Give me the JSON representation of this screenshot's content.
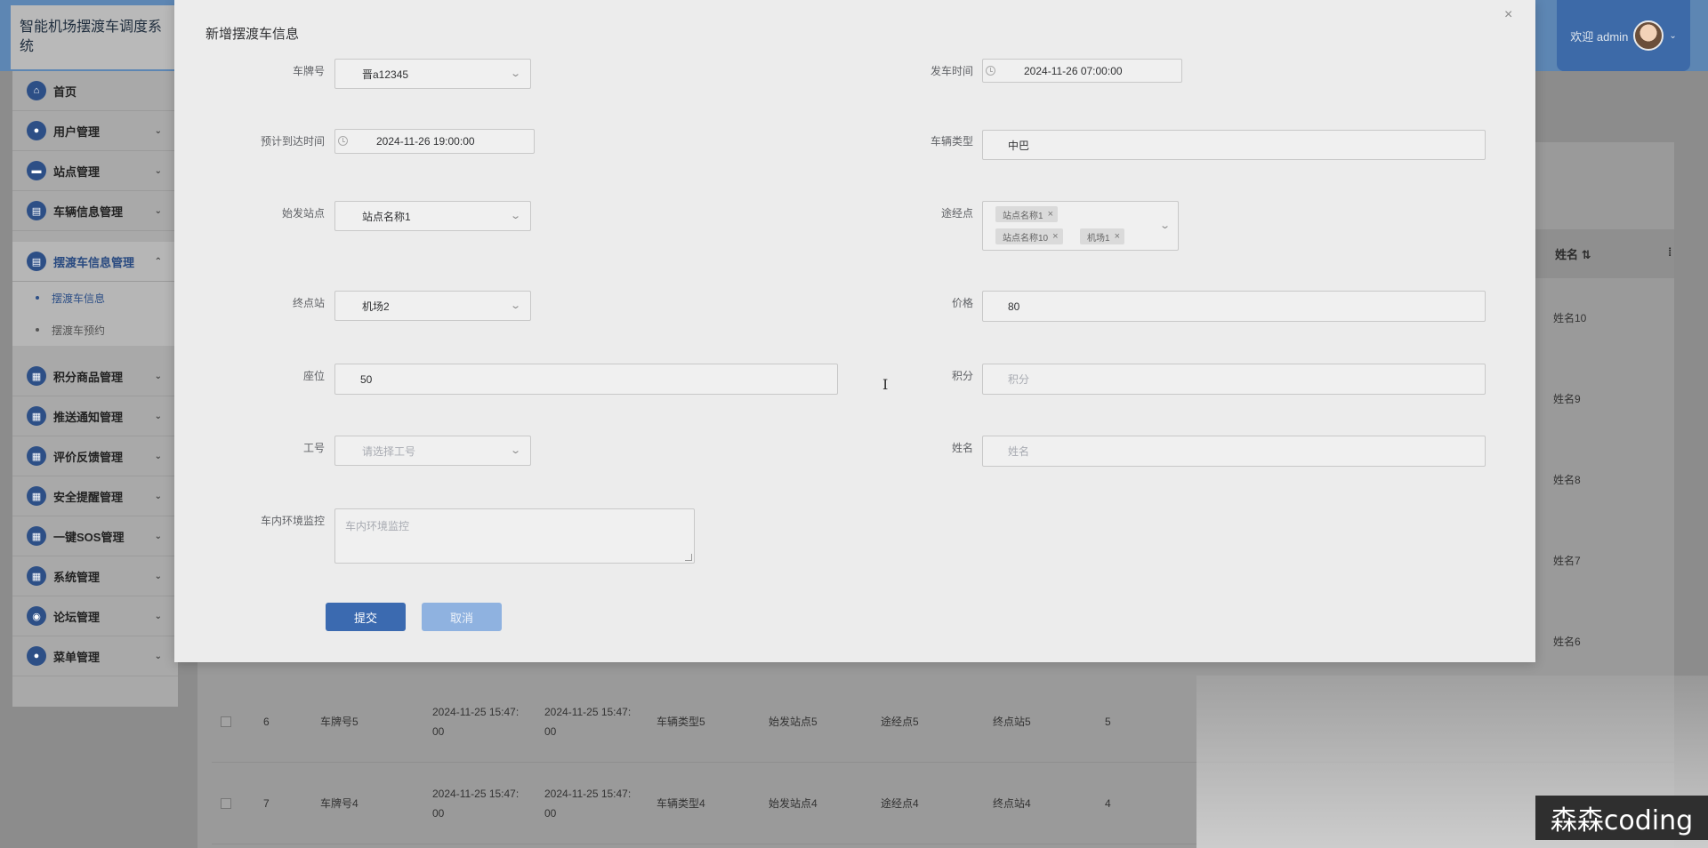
{
  "app": {
    "title": "智能机场摆渡车调度系统",
    "welcome": "欢迎 admin"
  },
  "sidebar": {
    "items": [
      {
        "label": "首页",
        "icon": "home-icon"
      },
      {
        "label": "用户管理",
        "icon": "user-icon"
      },
      {
        "label": "站点管理",
        "icon": "station-icon"
      },
      {
        "label": "车辆信息管理",
        "icon": "vehicle-icon"
      }
    ],
    "group": {
      "label": "摆渡车信息管理",
      "icon": "shuttle-icon",
      "children": [
        {
          "label": "摆渡车信息"
        },
        {
          "label": "摆渡车预约"
        }
      ]
    },
    "items_after": [
      {
        "label": "积分商品管理",
        "icon": "points-goods-icon"
      },
      {
        "label": "推送通知管理",
        "icon": "notification-icon"
      },
      {
        "label": "评价反馈管理",
        "icon": "feedback-icon"
      },
      {
        "label": "安全提醒管理",
        "icon": "safety-icon"
      },
      {
        "label": "一键SOS管理",
        "icon": "sos-icon"
      },
      {
        "label": "系统管理",
        "icon": "system-icon"
      },
      {
        "label": "论坛管理",
        "icon": "forum-icon"
      },
      {
        "label": "菜单管理",
        "icon": "menu-icon"
      }
    ]
  },
  "table": {
    "header_name": "姓名",
    "header_sort": "⇅",
    "visible_names": [
      "姓名10",
      "姓名9",
      "姓名8",
      "姓名7",
      "姓名6"
    ],
    "rows": [
      {
        "index": "6",
        "plate": "车牌号5",
        "depart": "2024-11-25 15:47:",
        "depart2": "00",
        "arrive": "2024-11-25 15:47:",
        "arrive2": "00",
        "type": "车辆类型5",
        "start": "始发站点5",
        "via": "途经点5",
        "end": "终点站5",
        "price": "5"
      },
      {
        "index": "7",
        "plate": "车牌号4",
        "depart": "2024-11-25 15:47:",
        "depart2": "00",
        "arrive": "2024-11-25 15:47:",
        "arrive2": "00",
        "type": "车辆类型4",
        "start": "始发站点4",
        "via": "途经点4",
        "end": "终点站4",
        "price": "4"
      }
    ]
  },
  "modal": {
    "title": "新增摆渡车信息",
    "close": "×",
    "fields": {
      "plate": {
        "label": "车牌号",
        "value": "晋a12345"
      },
      "depart_time": {
        "label": "发车时间",
        "value": "2024-11-26 07:00:00"
      },
      "arrive_time": {
        "label": "预计到达时间",
        "value": "2024-11-26 19:00:00"
      },
      "vehicle_type": {
        "label": "车辆类型",
        "value": "中巴"
      },
      "start_station": {
        "label": "始发站点",
        "value": "站点名称1"
      },
      "via_points": {
        "label": "途经点",
        "tags": [
          "站点名称1",
          "站点名称10",
          "机场1"
        ]
      },
      "end_station": {
        "label": "终点站",
        "value": "机场2"
      },
      "price": {
        "label": "价格",
        "value": "80"
      },
      "seats": {
        "label": "座位",
        "value": "50"
      },
      "points": {
        "label": "积分",
        "placeholder": "积分"
      },
      "work_no": {
        "label": "工号",
        "placeholder": "请选择工号"
      },
      "name": {
        "label": "姓名",
        "placeholder": "姓名"
      },
      "env_monitor": {
        "label": "车内环境监控",
        "placeholder": "车内环境监控"
      }
    },
    "buttons": {
      "submit": "提交",
      "cancel": "取消"
    }
  },
  "watermark": "森森coding"
}
